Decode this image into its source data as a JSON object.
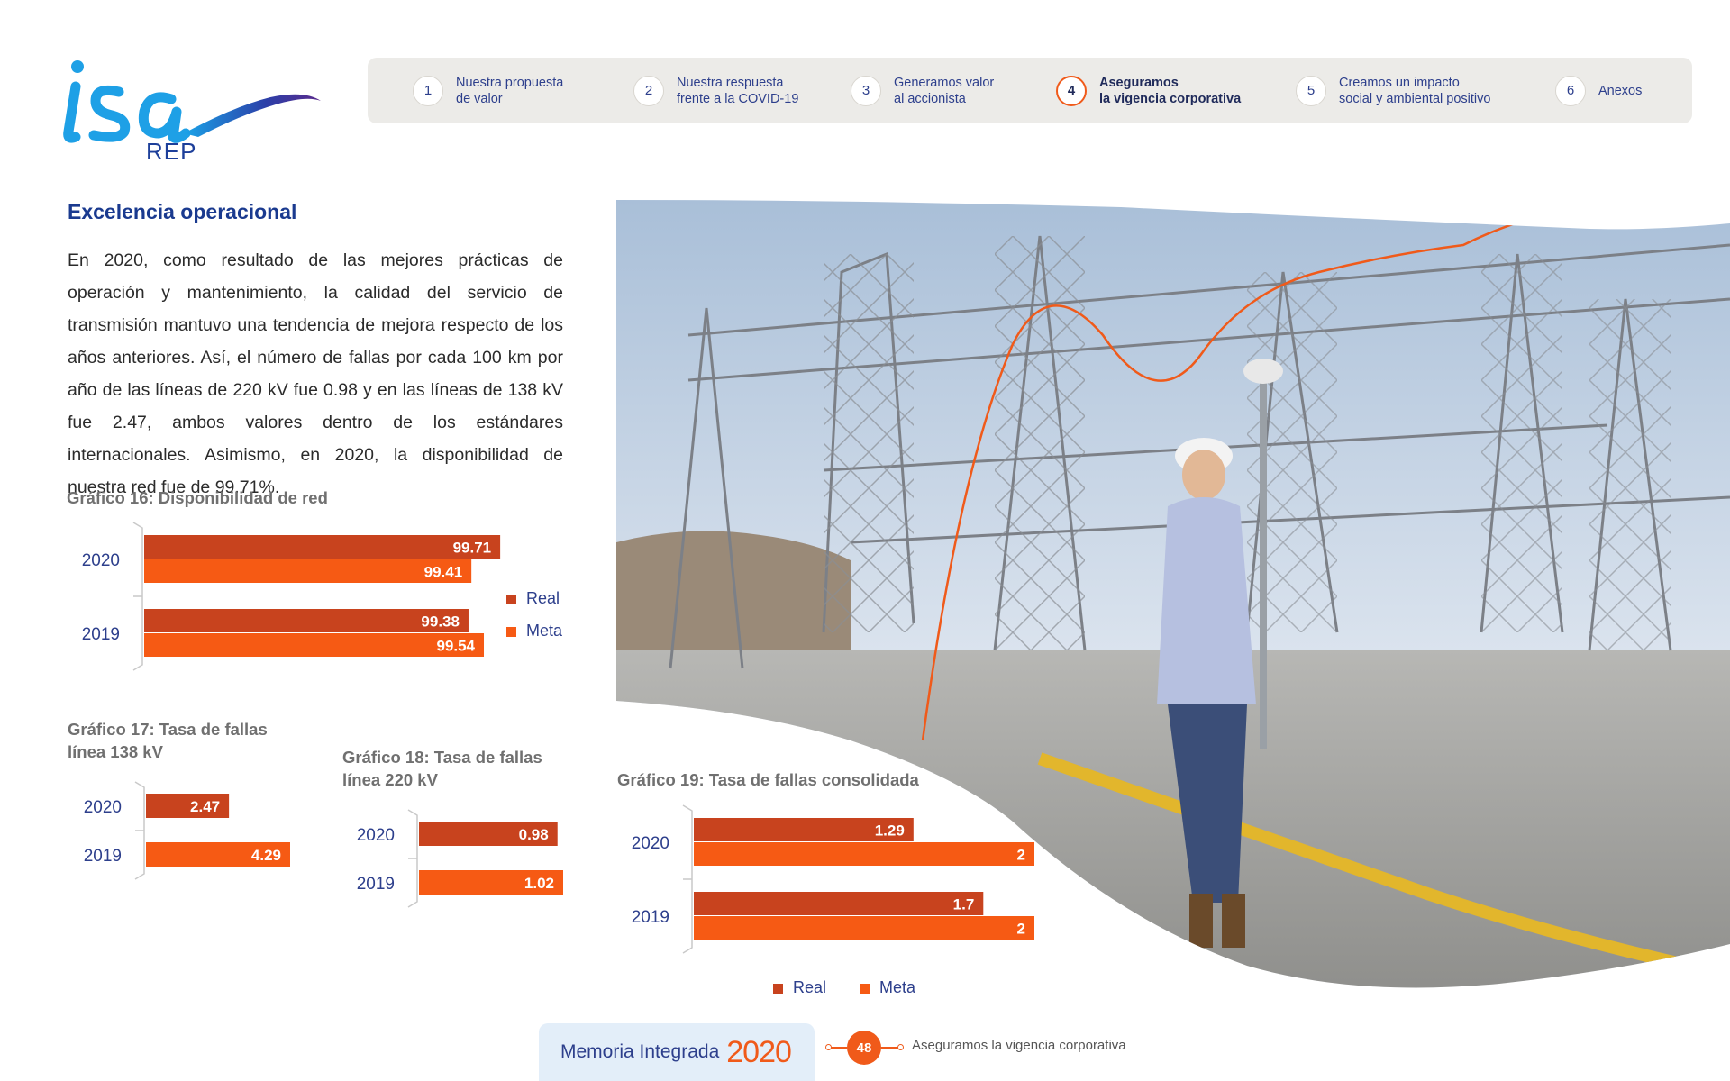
{
  "header": {
    "logo_text": "isa",
    "logo_sub": "REP",
    "nav": [
      {
        "num": "1",
        "label": "Nuestra propuesta\nde valor",
        "active": false
      },
      {
        "num": "2",
        "label": "Nuestra respuesta\nfrente a la COVID-19",
        "active": false
      },
      {
        "num": "3",
        "label": "Generamos valor\nal accionista",
        "active": false
      },
      {
        "num": "4",
        "label": "Aseguramos\nla vigencia corporativa",
        "active": true
      },
      {
        "num": "5",
        "label": "Creamos un impacto\nsocial y ambiental positivo",
        "active": false
      },
      {
        "num": "6",
        "label": "Anexos",
        "active": false
      }
    ]
  },
  "section": {
    "title": "Excelencia operacional",
    "body": "En 2020, como resultado de las mejores prácticas de operación y mantenimiento, la calidad del servicio de transmisión mantuvo una tendencia de mejora respecto de los años anteriores. Así, el número de fallas por cada 100 km por año de las líneas de 220 kV fue 0.98 y en las líneas de 138 kV fue 2.47, ambos valores dentro de los estándares internacionales. Asimismo, en 2020, la disponibilidad de nuestra red fue de 99.71%."
  },
  "colors": {
    "real": "#c8431e",
    "meta": "#f65a14",
    "brand_blue": "#1a3a8f",
    "accent_orange": "#f05a1a"
  },
  "chart_data": [
    {
      "id": "g16",
      "type": "bar",
      "title": "Gráfico 16: Disponibilidad de red",
      "categories": [
        "2020",
        "2019"
      ],
      "series": [
        {
          "name": "Real",
          "values": [
            99.71,
            99.38
          ]
        },
        {
          "name": "Meta",
          "values": [
            99.41,
            99.54
          ]
        }
      ],
      "legend": "right"
    },
    {
      "id": "g17",
      "type": "bar",
      "title": "Gráfico 17: Tasa de fallas\nlínea 138 kV",
      "categories": [
        "2020",
        "2019"
      ],
      "series": [
        {
          "values": [
            2.47,
            4.29
          ]
        }
      ]
    },
    {
      "id": "g18",
      "type": "bar",
      "title": "Gráfico 18: Tasa de fallas\nlínea 220 kV",
      "categories": [
        "2020",
        "2019"
      ],
      "series": [
        {
          "values": [
            0.98,
            1.02
          ]
        }
      ]
    },
    {
      "id": "g19",
      "type": "bar",
      "title": "Gráfico 19: Tasa de fallas consolidada",
      "categories": [
        "2020",
        "2019"
      ],
      "series": [
        {
          "name": "Real",
          "values": [
            1.29,
            1.7
          ]
        },
        {
          "name": "Meta",
          "values": [
            2,
            2
          ]
        }
      ],
      "legend": "bottom"
    }
  ],
  "footer": {
    "label": "Memoria Integrada",
    "year": "2020",
    "page": "48",
    "section": "Aseguramos la vigencia corporativa"
  }
}
